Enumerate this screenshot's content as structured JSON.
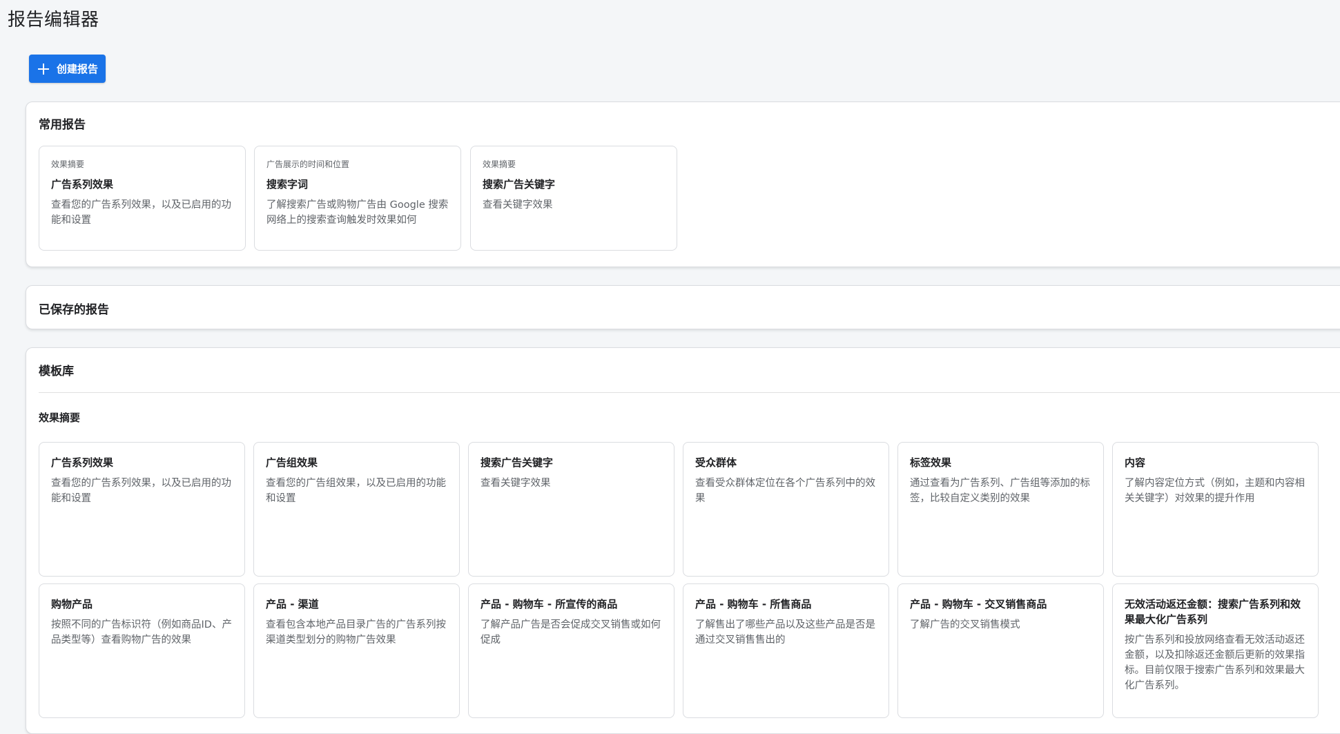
{
  "page": {
    "title": "报告编辑器"
  },
  "toolbar": {
    "create_label": "创建报告"
  },
  "common_reports": {
    "title": "常用报告",
    "cards": [
      {
        "overline": "效果摘要",
        "title": "广告系列效果",
        "desc": "查看您的广告系列效果，以及已启用的功能和设置"
      },
      {
        "overline": "广告展示的时间和位置",
        "title": "搜索字词",
        "desc": "了解搜索广告或购物广告由 Google 搜索网络上的搜索查询触发时效果如何"
      },
      {
        "overline": "效果摘要",
        "title": "搜索广告关键字",
        "desc": "查看关键字效果"
      }
    ]
  },
  "saved_reports": {
    "title": "已保存的报告"
  },
  "template_library": {
    "title": "模板库",
    "section_title": "效果摘要",
    "row1": [
      {
        "title": "广告系列效果",
        "desc": "查看您的广告系列效果，以及已启用的功能和设置"
      },
      {
        "title": "广告组效果",
        "desc": "查看您的广告组效果，以及已启用的功能和设置"
      },
      {
        "title": "搜索广告关键字",
        "desc": "查看关键字效果"
      },
      {
        "title": "受众群体",
        "desc": "查看受众群体定位在各个广告系列中的效果"
      },
      {
        "title": "标签效果",
        "desc": "通过查看为广告系列、广告组等添加的标签，比较自定义类别的效果"
      },
      {
        "title": "内容",
        "desc": "了解内容定位方式（例如，主题和内容相关关键字）对效果的提升作用"
      }
    ],
    "row2": [
      {
        "title": "购物产品",
        "desc": "按照不同的广告标识符（例如商品ID、产品类型等）查看购物广告的效果"
      },
      {
        "title": "产品 - 渠道",
        "desc": "查看包含本地产品目录广告的广告系列按渠道类型划分的购物广告效果"
      },
      {
        "title": "产品 - 购物车 - 所宣传的商品",
        "desc": "了解产品广告是否会促成交叉销售或如何促成"
      },
      {
        "title": "产品 - 购物车 - 所售商品",
        "desc": "了解售出了哪些产品以及这些产品是否是通过交叉销售售出的"
      },
      {
        "title": "产品 - 购物车 - 交叉销售商品",
        "desc": "了解广告的交叉销售模式"
      },
      {
        "title": "无效活动返还金额：搜索广告系列和效果最大化广告系列",
        "desc": "按广告系列和投放网络查看无效活动返还金额，以及扣除返还金额后更新的效果指标。目前仅限于搜索广告系列和效果最大化广告系列。"
      }
    ]
  }
}
